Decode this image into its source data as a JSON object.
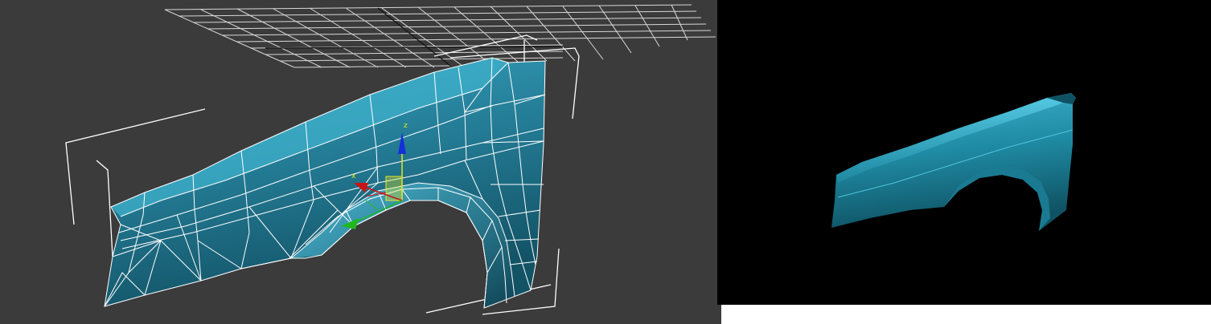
{
  "viewport_left": {
    "background": "#3b3b3b",
    "mesh_color": "#2a7f99",
    "wire_color": "#ffffff",
    "grid_color": "#d8d8d8",
    "gizmo": {
      "x_label": "x",
      "z_label": "z",
      "x_color": "#c81414",
      "y_color": "#1fb81f",
      "z_color": "#1430d6",
      "plane_color": "#e6e61e"
    }
  },
  "viewport_right": {
    "background": "#000000",
    "mesh_color": "#1f8aa3"
  }
}
